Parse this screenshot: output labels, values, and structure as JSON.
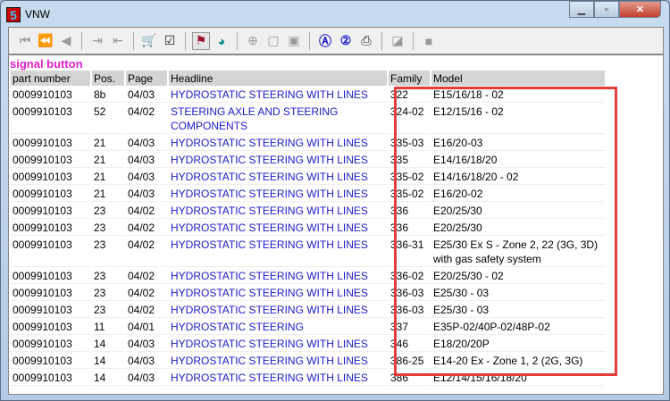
{
  "window": {
    "title": "VNW",
    "icon_text": "5"
  },
  "toolbar": {
    "buttons": [
      "first-icon",
      "rewind-icon",
      "previous-icon",
      "export-icon",
      "import-icon",
      "cart-icon",
      "checklist-icon",
      "signal-icon",
      "clock-icon",
      "zoom-icon",
      "page-icon",
      "page-alt-icon",
      "search-a-icon",
      "search-2-icon",
      "print-icon",
      "note-icon",
      "stop-icon"
    ]
  },
  "signal_label": "signal button",
  "table": {
    "headers": [
      "part number",
      "Pos.",
      "Page",
      "Headline",
      "Family",
      "Model"
    ],
    "rows": [
      [
        "0009910103",
        "8b",
        "04/03",
        "HYDROSTATIC STEERING WITH LINES",
        "322",
        "E15/16/18 - 02"
      ],
      [
        "0009910103",
        "52",
        "04/02",
        "STEERING AXLE AND STEERING COMPONENTS",
        "324-02",
        "E12/15/16 - 02"
      ],
      [
        "0009910103",
        "21",
        "04/03",
        "HYDROSTATIC STEERING WITH LINES",
        "335-03",
        "E16/20-03"
      ],
      [
        "0009910103",
        "21",
        "04/03",
        "HYDROSTATIC STEERING WITH LINES",
        "335",
        "E14/16/18/20"
      ],
      [
        "0009910103",
        "21",
        "04/03",
        "HYDROSTATIC STEERING WITH LINES",
        "335-02",
        "E14/16/18/20 - 02"
      ],
      [
        "0009910103",
        "21",
        "04/03",
        "HYDROSTATIC STEERING WITH LINES",
        "335-02",
        "E16/20-02"
      ],
      [
        "0009910103",
        "23",
        "04/02",
        "HYDROSTATIC STEERING WITH LINES",
        "336",
        "E20/25/30"
      ],
      [
        "0009910103",
        "23",
        "04/02",
        "HYDROSTATIC STEERING WITH LINES",
        "336",
        "E20/25/30"
      ],
      [
        "0009910103",
        "23",
        "04/02",
        "HYDROSTATIC STEERING WITH LINES",
        "336-31",
        "E25/30 Ex S - Zone 2, 22 (3G, 3D) with gas safety system"
      ],
      [
        "0009910103",
        "23",
        "04/02",
        "HYDROSTATIC STEERING WITH LINES",
        "336-02",
        "E20/25/30 - 02"
      ],
      [
        "0009910103",
        "23",
        "04/02",
        "HYDROSTATIC STEERING WITH LINES",
        "336-03",
        "E25/30 - 03"
      ],
      [
        "0009910103",
        "23",
        "04/02",
        "HYDROSTATIC STEERING WITH LINES",
        "336-03",
        "E25/30 - 03"
      ],
      [
        "0009910103",
        "11",
        "04/01",
        "HYDROSTATIC STEERING",
        "337",
        "E35P-02/40P-02/48P-02"
      ],
      [
        "0009910103",
        "14",
        "04/03",
        "HYDROSTATIC STEERING WITH LINES",
        "346",
        "E18/20/20P"
      ],
      [
        "0009910103",
        "14",
        "04/03",
        "HYDROSTATIC STEERING WITH LINES",
        "386-25",
        "E14-20 Ex - Zone 1, 2 (2G, 3G)"
      ],
      [
        "0009910103",
        "14",
        "04/03",
        "HYDROSTATIC STEERING WITH LINES",
        "386",
        "E12/14/15/16/18/20"
      ]
    ]
  },
  "colors": {
    "signal": "#e020d0",
    "headline": "#1a1acc",
    "highlight": "#e23c3c"
  }
}
